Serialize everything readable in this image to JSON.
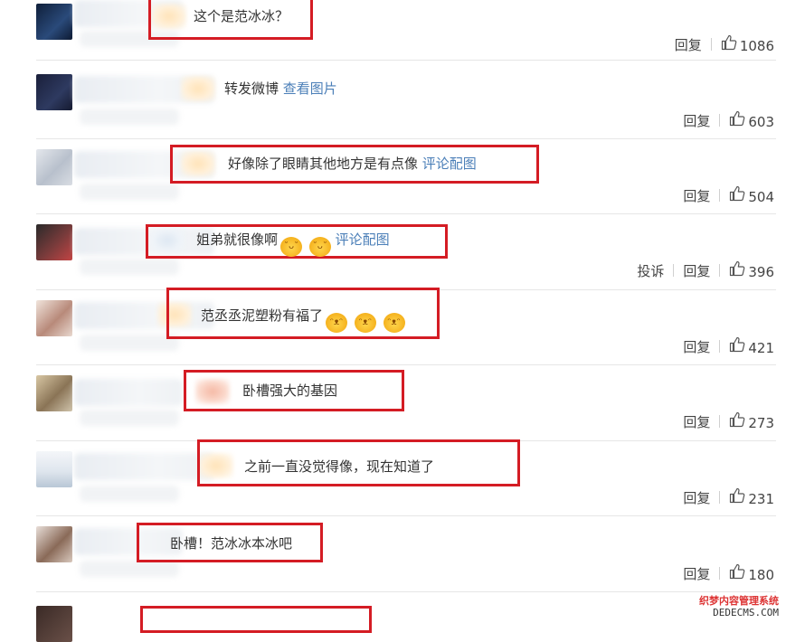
{
  "comments": [
    {
      "text": "这个是范冰冰？",
      "link": "",
      "emoji_count": 0,
      "emoji_name": "",
      "report": "",
      "reply": "回复",
      "likes": "1086",
      "avatar_color": "#1e3354"
    },
    {
      "text": "转发微博",
      "link": "查看图片",
      "emoji_count": 0,
      "emoji_name": "",
      "report": "",
      "reply": "回复",
      "likes": "603",
      "avatar_color": "#232c4a"
    },
    {
      "text": "好像除了眼睛其他地方是有点像",
      "link": "评论配图",
      "emoji_count": 0,
      "emoji_name": "",
      "report": "",
      "reply": "回复",
      "likes": "504",
      "avatar_color": "#c9cfd8"
    },
    {
      "text": "姐弟就很像啊",
      "link": "评论配图",
      "emoji_count": 2,
      "emoji_name": "shy-face-emoji",
      "report": "投诉",
      "reply": "回复",
      "likes": "396",
      "avatar_color": "#6a3a3a"
    },
    {
      "text": "范丞丞泥塑粉有福了",
      "link": "",
      "emoji_count": 3,
      "emoji_name": "doge-emoji",
      "report": "",
      "reply": "回复",
      "likes": "421",
      "avatar_color": "#c9a89a"
    },
    {
      "text": "卧槽强大的基因",
      "link": "",
      "emoji_count": 0,
      "emoji_name": "",
      "report": "",
      "reply": "回复",
      "likes": "273",
      "avatar_color": "#b9a07a"
    },
    {
      "text": "之前一直没觉得像，现在知道了",
      "link": "",
      "emoji_count": 0,
      "emoji_name": "",
      "report": "",
      "reply": "回复",
      "likes": "231",
      "avatar_color": "#a8bdcf"
    },
    {
      "text": "卧槽！范冰冰本冰吧",
      "link": "",
      "emoji_count": 0,
      "emoji_name": "",
      "report": "",
      "reply": "回复",
      "likes": "180",
      "avatar_color": "#7a5a4a"
    }
  ],
  "watermark": {
    "line1": "织梦内容管理系统",
    "line2": "DEDECMS.COM"
  },
  "colors": {
    "highlight": "#d41c24",
    "link": "#4b7fb8"
  }
}
